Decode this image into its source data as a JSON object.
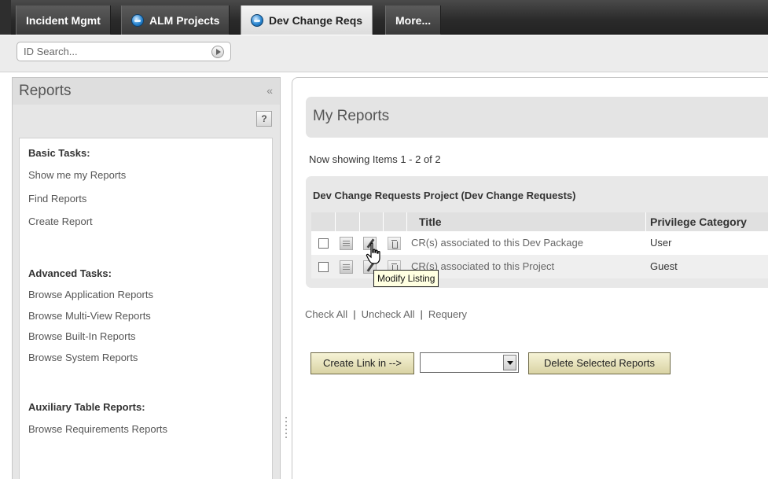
{
  "tabs": [
    {
      "label": "Incident Mgmt",
      "icon": "none",
      "active": false
    },
    {
      "label": "ALM Projects",
      "icon": "globe-icon",
      "active": false
    },
    {
      "label": "Dev Change Reqs",
      "icon": "globe-icon",
      "active": true
    },
    {
      "label": "More...",
      "icon": "none",
      "active": false
    }
  ],
  "search": {
    "placeholder": "ID Search...",
    "value": ""
  },
  "left_panel": {
    "title": "Reports",
    "collapse_symbol": "«",
    "help_symbol": "?",
    "basic_tasks": {
      "heading": "Basic Tasks:",
      "items": [
        "Show me my Reports",
        "Find Reports",
        "Create Report"
      ]
    },
    "advanced_tasks": {
      "heading": "Advanced Tasks:",
      "items": [
        "Browse Application Reports",
        "Browse Multi-View Reports",
        "Browse Built-In Reports",
        "Browse System Reports"
      ]
    },
    "auxiliary": {
      "heading": "Auxiliary Table Reports:",
      "items": [
        "Browse Requirements Reports"
      ]
    }
  },
  "main": {
    "title": "My Reports",
    "showing": "Now showing Items 1 - 2 of 2",
    "group_title": "Dev Change Requests Project (Dev Change Requests)",
    "columns": {
      "title": "Title",
      "privilege": "Privilege Category"
    },
    "rows": [
      {
        "title": "CR(s) associated to this Dev Package",
        "privilege": "User"
      },
      {
        "title": "CR(s) associated to this Project",
        "privilege": "Guest"
      }
    ],
    "tooltip": "Modify Listing",
    "actions": {
      "check_all": "Check All",
      "uncheck_all": "Uncheck All",
      "requery": "Requery",
      "separator": "|"
    },
    "buttons": {
      "create_link": "Create Link in -->",
      "delete_selected": "Delete Selected Reports"
    },
    "link_target_select": {
      "value": ""
    }
  },
  "colors": {
    "topbar": "#2a2a2a",
    "button_bg": "#e8e2bd",
    "tooltip_bg": "#ffffe1",
    "panel_bg": "#e6e6e6"
  }
}
